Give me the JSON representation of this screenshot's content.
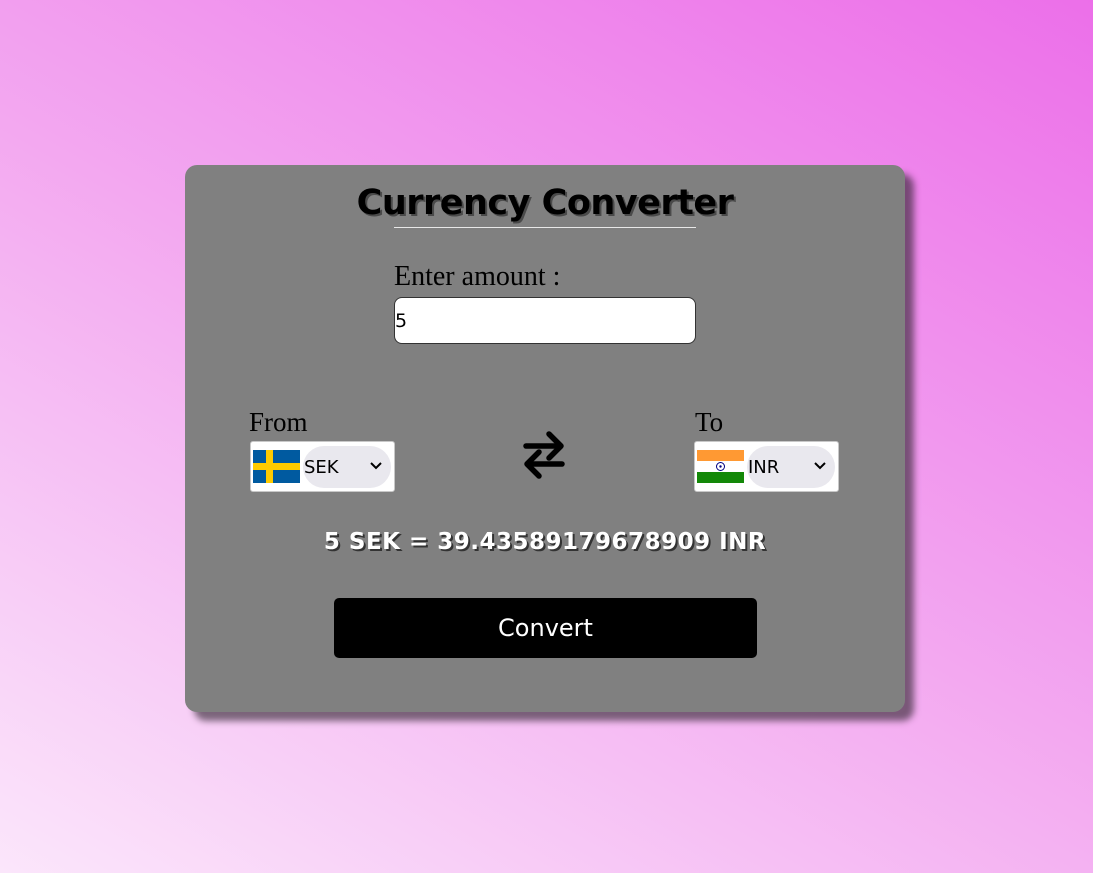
{
  "title": "Currency Converter",
  "amount": {
    "label": "Enter amount :",
    "value": "5"
  },
  "from": {
    "label": "From",
    "selected": "SEK",
    "flag_icon": "sweden-flag-icon"
  },
  "to": {
    "label": "To",
    "selected": "INR",
    "flag_icon": "india-flag-icon"
  },
  "swap_icon": "swap-arrows-icon",
  "result": "5 SEK = 39.43589179678909 INR",
  "convert_label": "Convert",
  "colors": {
    "card": "#808080",
    "button": "#000000",
    "gradient_start": "#fbe6fb",
    "gradient_end": "#ec6fe9"
  }
}
